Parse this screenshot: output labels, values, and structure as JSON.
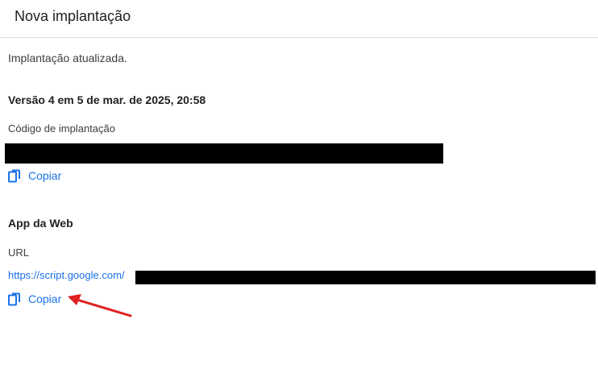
{
  "dialog": {
    "title": "Nova implantação",
    "status_message": "Implantação atualizada.",
    "version_text": "Versão 4 em 5 de mar. de 2025, 20:58"
  },
  "deployment_code": {
    "label": "Código de implantação",
    "copy_label": "Copiar",
    "copy_icon": "copy-icon"
  },
  "web_app": {
    "title": "App da Web",
    "url_label": "URL",
    "url_visible": "https://script.google.com/",
    "copy_label": "Copiar",
    "copy_icon": "copy-icon"
  },
  "colors": {
    "link": "#1a73e8",
    "annotation_arrow": "#e02020",
    "redaction": "#000000"
  }
}
